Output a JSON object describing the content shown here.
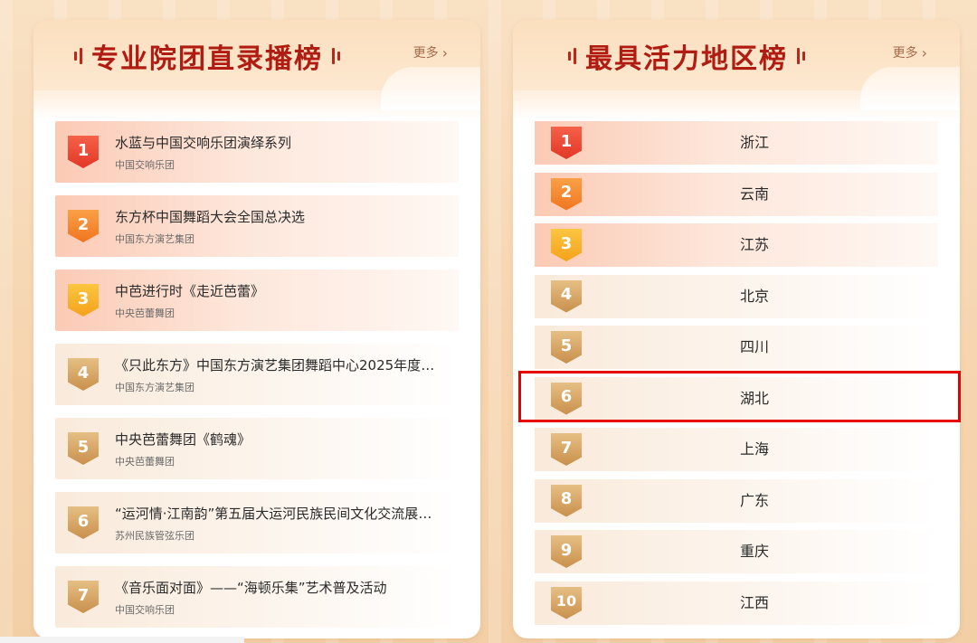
{
  "left_panel": {
    "title": "专业院团直录播榜",
    "more_label": "更多",
    "items": [
      {
        "rank": "1",
        "title": "水蓝与中国交响乐团演绎系列",
        "subtitle": "中国交响乐团"
      },
      {
        "rank": "2",
        "title": "东方杯中国舞蹈大会全国总决选",
        "subtitle": "中国东方演艺集团"
      },
      {
        "rank": "3",
        "title": "中芭进行时《走近芭蕾》",
        "subtitle": "中央芭蕾舞团"
      },
      {
        "rank": "4",
        "title": "《只此东方》中国东方演艺集团舞蹈中心2025年度业...",
        "subtitle": "中国东方演艺集团"
      },
      {
        "rank": "5",
        "title": "中央芭蕾舞团《鹤魂》",
        "subtitle": "中央芭蕾舞团"
      },
      {
        "rank": "6",
        "title": "“运河情·江南韵”第五届大运河民族民间文化交流展示...",
        "subtitle": "苏州民族管弦乐团"
      },
      {
        "rank": "7",
        "title": "《音乐面对面》——“海顿乐集”艺术普及活动",
        "subtitle": "中国交响乐团"
      }
    ]
  },
  "right_panel": {
    "title": "最具活力地区榜",
    "more_label": "更多",
    "items": [
      {
        "rank": "1",
        "name": "浙江"
      },
      {
        "rank": "2",
        "name": "云南"
      },
      {
        "rank": "3",
        "name": "江苏"
      },
      {
        "rank": "4",
        "name": "北京"
      },
      {
        "rank": "5",
        "name": "四川"
      },
      {
        "rank": "6",
        "name": "湖北"
      },
      {
        "rank": "7",
        "name": "上海"
      },
      {
        "rank": "8",
        "name": "广东"
      },
      {
        "rank": "9",
        "name": "重庆"
      },
      {
        "rank": "10",
        "name": "江西"
      }
    ]
  },
  "highlighted_item": "湖北",
  "colors": {
    "title": "#b01c12",
    "badge_red": "#e23626",
    "badge_orange": "#f17520",
    "badge_yellow": "#f5a21c",
    "badge_tan": "#c98f4c",
    "highlight_border": "#e60000"
  }
}
